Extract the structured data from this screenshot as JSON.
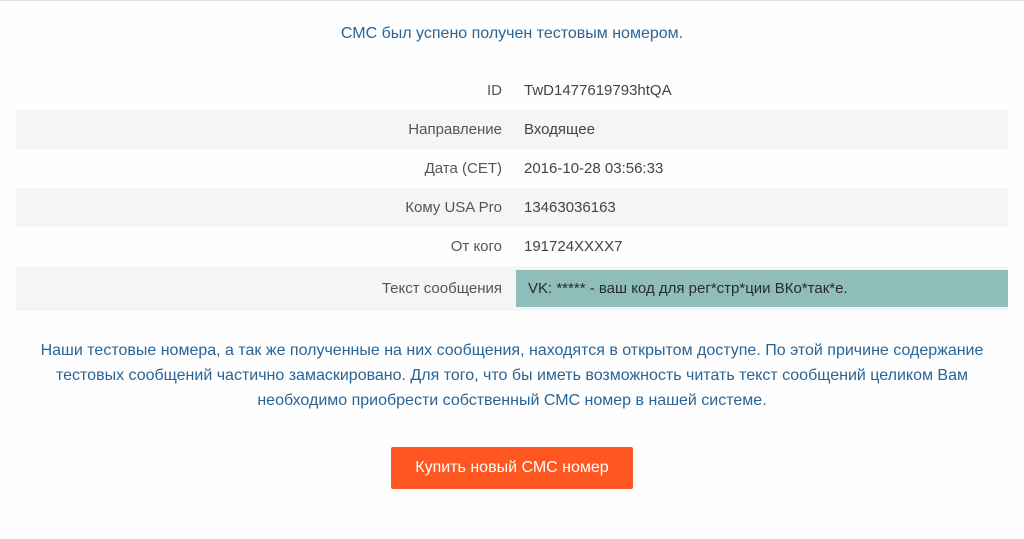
{
  "success_message": "СМС был успено получен тестовым номером.",
  "details": {
    "id_label": "ID",
    "id_value": "TwD1477619793htQA",
    "direction_label": "Направление",
    "direction_value": "Входящее",
    "date_label": "Дата (CET)",
    "date_value": "2016-10-28 03:56:33",
    "to_label": "Кому USA Pro",
    "to_value": "13463036163",
    "from_label": "От кого",
    "from_value": "191724XXXX7",
    "text_label": "Текст сообщения",
    "text_value": "VK: ***** - ваш код для рег*стр*ции ВКо*так*е."
  },
  "notice_text": "Наши тестовые номера, а так же полученные на них сообщения, находятся в открытом доступе. По этой причине содержание тестовых сообщений частично замаскировано. Для того, что бы иметь возможность читать текст сообщений целиком Вам необходимо приобрести собственный СМС номер в нашей системе.",
  "buy_button_label": "Купить новый СМС номер"
}
